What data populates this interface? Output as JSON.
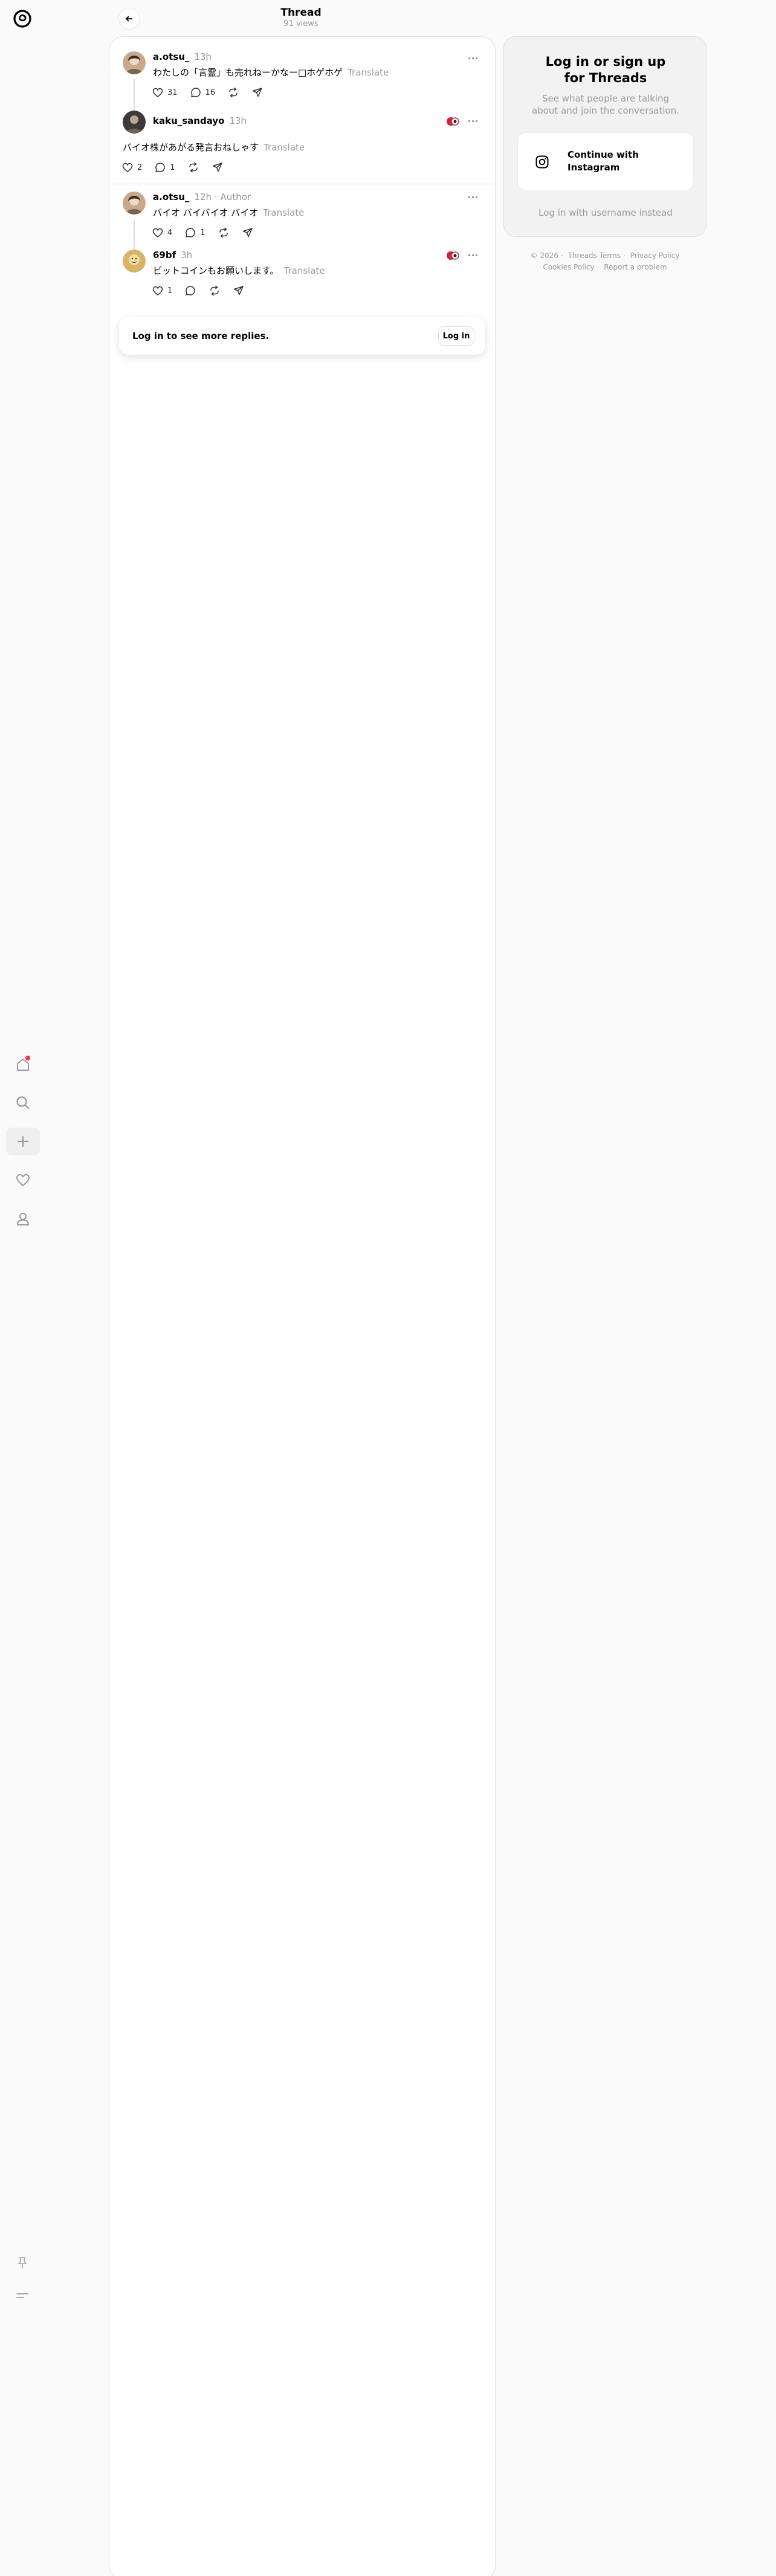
{
  "header": {
    "title": "Thread",
    "views": "91 views"
  },
  "posts": [
    {
      "username": "a.otsu_",
      "time": "13h",
      "text": "わたしの「言霊」も売れねーかなー□ホゲホゲ",
      "translate": "Translate",
      "likes": "31",
      "replies": "16"
    },
    {
      "username": "kaku_sandayo",
      "time": "13h",
      "text": "バイオ株があがる発言おねしゃす",
      "translate": "Translate",
      "likes": "2",
      "replies": "1"
    },
    {
      "username": "a.otsu_",
      "time": "12h",
      "author_tag": "· Author",
      "text": "バイオ バイバイオ バイオ",
      "translate": "Translate",
      "likes": "4",
      "replies": "1"
    },
    {
      "username": "69bf",
      "time": "3h",
      "text": "ビットコインもお願いします。",
      "translate": "Translate",
      "likes": "1",
      "replies": ""
    }
  ],
  "login_prompt": {
    "message": "Log in to see more replies.",
    "button": "Log in"
  },
  "side": {
    "title": "Log in or sign up for Threads",
    "subtitle": "See what people are talking about and join the conversation.",
    "instagram_button": "Continue with Instagram",
    "alt_login": "Log in with username instead"
  },
  "footer": {
    "copyright": "© 2026",
    "terms": "Threads Terms",
    "privacy": "Privacy Policy",
    "cookies": "Cookies Policy",
    "report": "Report a problem"
  },
  "icons": {
    "nav": [
      "home-icon",
      "search-icon",
      "plus-icon",
      "heart-icon",
      "profile-icon"
    ],
    "bottom": [
      "pin-icon",
      "menu-icon"
    ],
    "post_actions": [
      "heart-icon",
      "comment-icon",
      "repost-icon",
      "share-icon"
    ]
  },
  "colors": {
    "notification": "#ff3040",
    "muted": "#999999",
    "background": "#fafafa"
  }
}
